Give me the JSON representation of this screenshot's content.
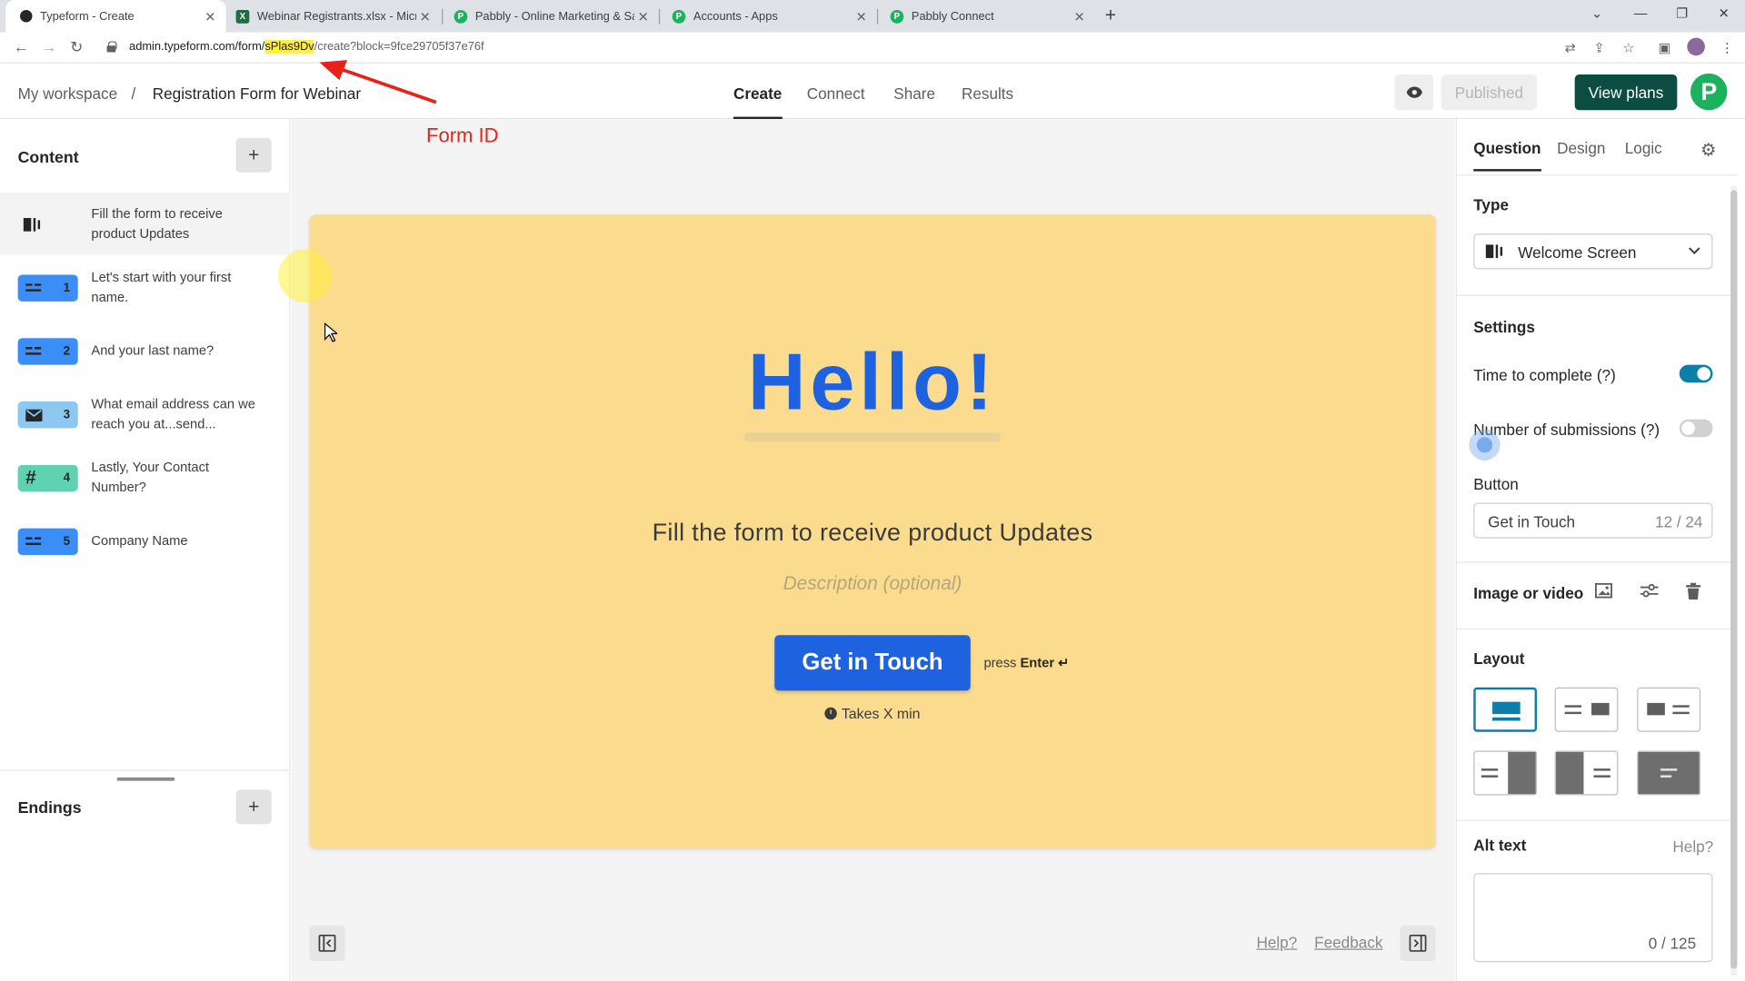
{
  "browser": {
    "tabs": [
      {
        "title": "Typeform - Create",
        "icon": "typeform-icon"
      },
      {
        "title": "Webinar Registrants.xlsx - Micros",
        "icon": "excel-icon"
      },
      {
        "title": "Pabbly - Online Marketing & Sal",
        "icon": "pabbly-icon"
      },
      {
        "title": "Accounts - Apps",
        "icon": "pabbly-icon"
      },
      {
        "title": "Pabbly Connect",
        "icon": "pabbly-icon"
      }
    ],
    "url_prefix": "admin.typeform.com/form/",
    "url_highlight": "sPlas9Dv",
    "url_suffix": "/create?block=9fce29705f37e76f"
  },
  "annotation": {
    "label": "Form ID",
    "color": "#e8211a"
  },
  "header": {
    "breadcrumb_root": "My workspace",
    "breadcrumb_sep": "/",
    "form_title": "Registration Form for Webinar",
    "nav": [
      "Create",
      "Connect",
      "Share",
      "Results"
    ],
    "published_label": "Published",
    "view_plans_label": "View plans",
    "avatar_letter": "P"
  },
  "left": {
    "content_title": "Content",
    "endings_title": "Endings",
    "add": "+",
    "items": [
      {
        "num": "",
        "text": "Fill the form to receive product Updates",
        "icon": "welcome-screen-icon"
      },
      {
        "num": "1",
        "text": "Let's start with your first name.",
        "icon": "short-text-icon"
      },
      {
        "num": "2",
        "text": "And your last name?",
        "icon": "short-text-icon"
      },
      {
        "num": "3",
        "text": "What email address can we reach you at...send...",
        "icon": "email-icon"
      },
      {
        "num": "4",
        "text": "Lastly, Your Contact Number?",
        "icon": "number-icon"
      },
      {
        "num": "5",
        "text": "Company Name",
        "icon": "short-text-icon"
      }
    ]
  },
  "form": {
    "heading": "Hello!",
    "title": "Fill the form to receive product Updates",
    "description_placeholder": "Description (optional)",
    "button_label": "Get in Touch",
    "press": "press",
    "enter": "Enter ↵",
    "takes": "Takes X min",
    "bg_color": "#fbdc8e",
    "accent": "#1f62e0"
  },
  "footer": {
    "help": "Help?",
    "feedback": "Feedback"
  },
  "right": {
    "tabs": [
      "Question",
      "Design",
      "Logic"
    ],
    "type_label": "Type",
    "type_value": "Welcome Screen",
    "settings_label": "Settings",
    "time_to_complete": "Time to complete (?)",
    "time_to_complete_on": true,
    "num_submissions": "Number of submissions (?)",
    "num_submissions_on": false,
    "button_label": "Button",
    "button_value": "Get in Touch",
    "button_count": "12 / 24",
    "image_or_video": "Image or video",
    "layout_label": "Layout",
    "alt_text_label": "Alt text",
    "alt_help": "Help?",
    "alt_count": "0 / 125"
  }
}
